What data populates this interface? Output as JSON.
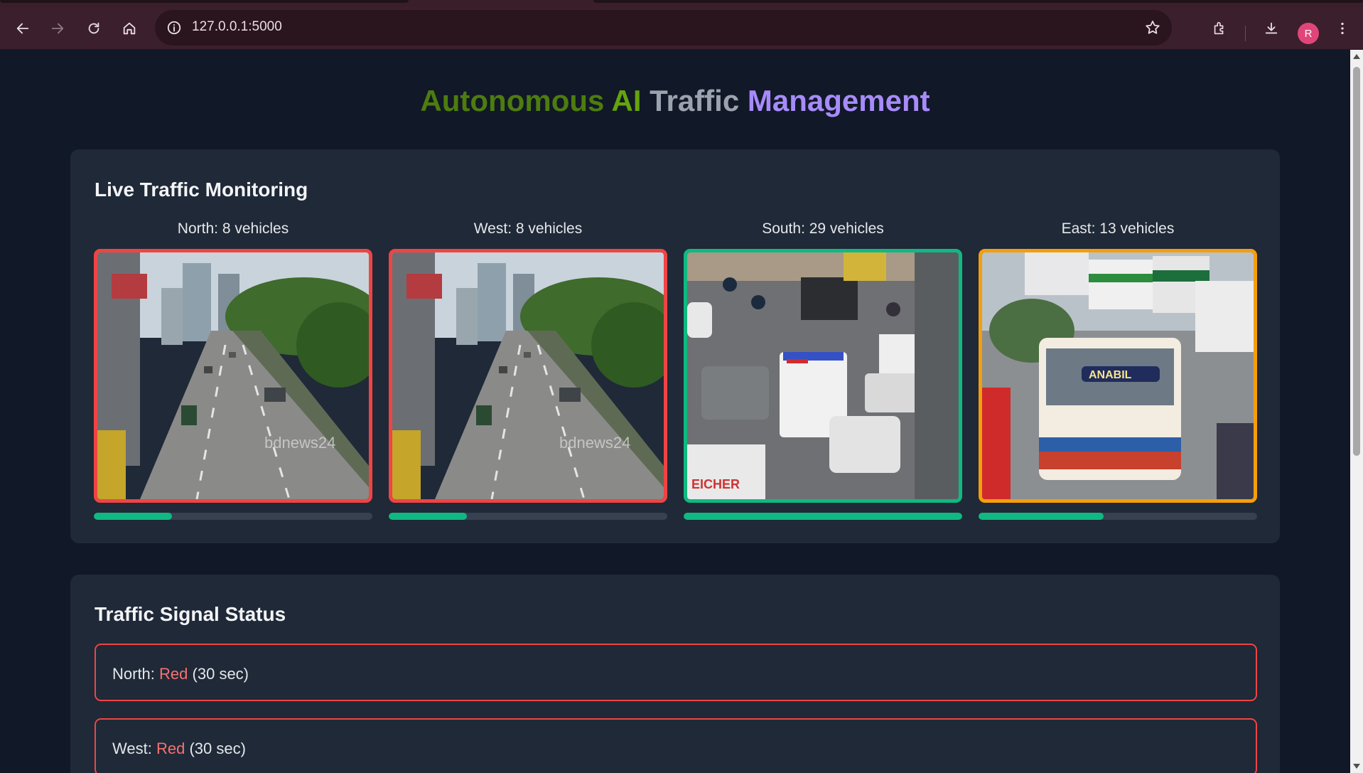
{
  "browser": {
    "url": "127.0.0.1:5000",
    "profile_initial": "R",
    "icons": [
      "back-icon",
      "forward-icon",
      "reload-icon",
      "home-icon",
      "site-info-icon",
      "bookmark-star-icon",
      "extensions-icon",
      "download-icon",
      "menu-icon"
    ]
  },
  "page": {
    "title_words": [
      "Autonomous",
      "AI",
      "Traffic",
      "Management"
    ],
    "title_colors": [
      "#4d7c0f",
      "#65a30d",
      "#9ca3af",
      "#a78bfa"
    ]
  },
  "monitoring": {
    "heading": "Live Traffic Monitoring",
    "cameras": [
      {
        "label": "North: 8 vehicles",
        "status_color": "#ef4444",
        "density_fraction": 0.28
      },
      {
        "label": "West: 8 vehicles",
        "status_color": "#ef4444",
        "density_fraction": 0.28
      },
      {
        "label": "South: 29 vehicles",
        "status_color": "#10b981",
        "density_fraction": 1.0
      },
      {
        "label": "East: 13 vehicles",
        "status_color": "#f59e0b",
        "density_fraction": 0.45
      }
    ]
  },
  "signals": {
    "heading": "Traffic Signal Status",
    "items": [
      {
        "direction": "North:",
        "state": "Red",
        "duration": "(30 sec)"
      },
      {
        "direction": "West:",
        "state": "Red",
        "duration": "(30 sec)"
      }
    ]
  }
}
